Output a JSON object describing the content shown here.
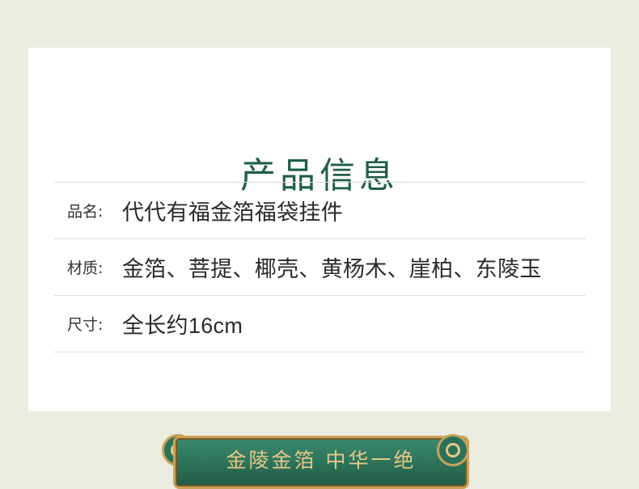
{
  "title": "产品信息",
  "rows": [
    {
      "label": "品名:",
      "value": "代代有福金箔福袋挂件"
    },
    {
      "label": "材质:",
      "value": "金箔、菩提、椰壳、黄杨木、崖柏、东陵玉"
    },
    {
      "label": "尺寸:",
      "value": "全长约16cm"
    }
  ],
  "banner": {
    "text": "金陵金箔 中华一绝"
  },
  "colors": {
    "background": "#ebede0",
    "title": "#1f5d4b",
    "banner_green": "#2c7159",
    "banner_gold": "#c9a25a"
  }
}
